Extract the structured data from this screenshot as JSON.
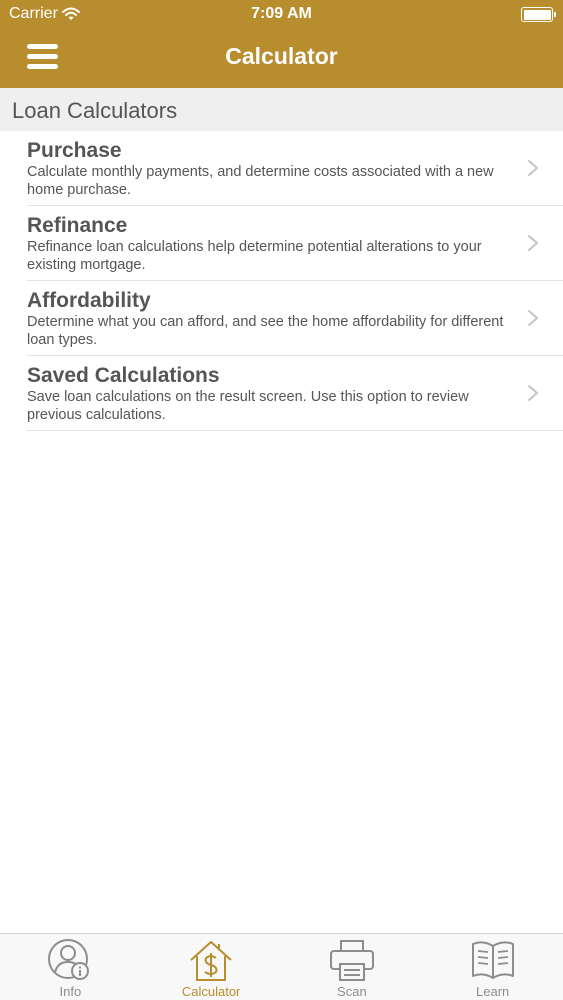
{
  "status_bar": {
    "carrier": "Carrier",
    "time": "7:09 AM"
  },
  "nav": {
    "title": "Calculator"
  },
  "section": {
    "title": "Loan Calculators"
  },
  "items": [
    {
      "title": "Purchase",
      "description": "Calculate monthly payments, and determine costs associated with a new home purchase."
    },
    {
      "title": "Refinance",
      "description": "Refinance loan calculations help determine potential alterations to your existing mortgage."
    },
    {
      "title": "Affordability",
      "description": "Determine what you can afford, and see the home affordability for different loan types."
    },
    {
      "title": "Saved Calculations",
      "description": "Save loan calculations on the result screen. Use this option to review previous calculations."
    }
  ],
  "tabs": [
    {
      "label": "Info",
      "icon": "person-info-icon"
    },
    {
      "label": "Calculator",
      "icon": "house-dollar-icon",
      "active": true
    },
    {
      "label": "Scan",
      "icon": "scanner-icon"
    },
    {
      "label": "Learn",
      "icon": "book-icon"
    }
  ],
  "colors": {
    "accent": "#b78d2e",
    "inactive_tab": "#8d8d8d",
    "section_bg": "#efefef"
  }
}
